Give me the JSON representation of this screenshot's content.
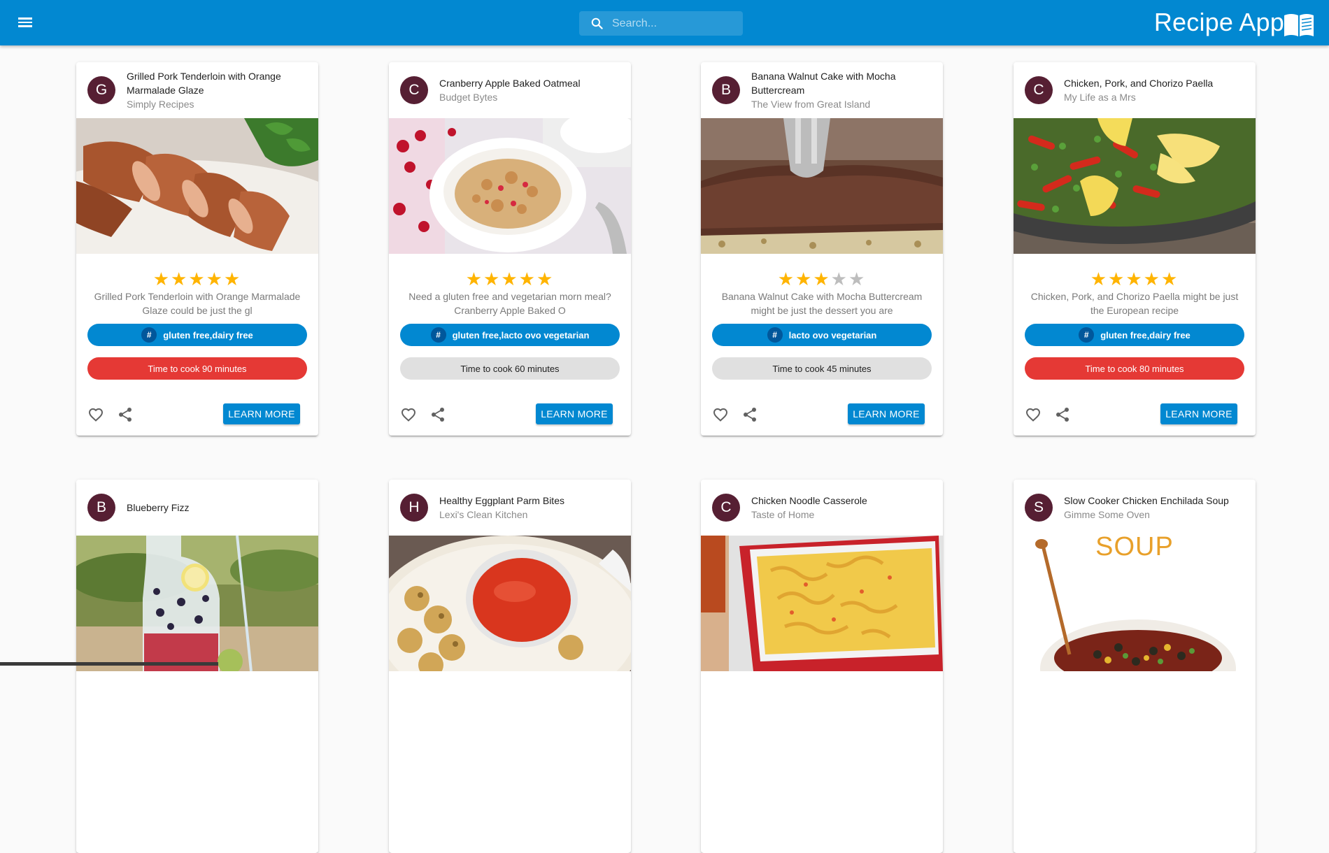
{
  "appbar": {
    "title": "Recipe App",
    "search_placeholder": "Search...",
    "brand_color": "#0288d1",
    "icons": [
      "menu-icon",
      "search-icon",
      "open-book-icon"
    ]
  },
  "cards": [
    {
      "avatar": "G",
      "title": "Grilled Pork Tenderloin with Orange Marmalade Glaze",
      "source": "Simply Recipes",
      "rating": 5,
      "description": "Grilled Pork Tenderloin with Orange Marmalade Glaze could be just the gl",
      "tag_symbol": "#",
      "tags": "gluten free,dairy free",
      "cook_time": "Time to cook 90 minutes",
      "time_style": "hot",
      "button": "LEARN MORE"
    },
    {
      "avatar": "C",
      "title": "Cranberry Apple Baked Oatmeal",
      "source": "Budget Bytes",
      "rating": 5,
      "description": "Need a gluten free and vegetarian morn meal? Cranberry Apple Baked O",
      "tag_symbol": "#",
      "tags": "gluten free,lacto ovo vegetarian",
      "cook_time": "Time to cook 60 minutes",
      "time_style": "norm",
      "button": "LEARN MORE"
    },
    {
      "avatar": "B",
      "title": "Banana Walnut Cake with Mocha Buttercream",
      "source": "The View from Great Island",
      "rating": 3,
      "description": "Banana Walnut Cake with Mocha Buttercream might be just the dessert you are",
      "tag_symbol": "#",
      "tags": "lacto ovo vegetarian",
      "cook_time": "Time to cook 45 minutes",
      "time_style": "norm",
      "button": "LEARN MORE"
    },
    {
      "avatar": "C",
      "title": "Chicken, Pork, and Chorizo Paella",
      "source": "My Life as a Mrs",
      "rating": 5,
      "description": "Chicken, Pork, and Chorizo Paella might be just the European recipe",
      "tag_symbol": "#",
      "tags": "gluten free,dairy free",
      "cook_time": "Time to cook 80 minutes",
      "time_style": "hot",
      "button": "LEARN MORE"
    },
    {
      "avatar": "B",
      "title": "Blueberry Fizz",
      "source": "",
      "rating": 0,
      "description": "",
      "tag_symbol": "",
      "tags": "",
      "cook_time": "",
      "time_style": "norm",
      "button": ""
    },
    {
      "avatar": "H",
      "title": "Healthy Eggplant Parm Bites",
      "source": "Lexi's Clean Kitchen",
      "rating": 0,
      "description": "",
      "tag_symbol": "",
      "tags": "",
      "cook_time": "",
      "time_style": "norm",
      "button": ""
    },
    {
      "avatar": "C",
      "title": "Chicken Noodle Casserole",
      "source": "Taste of Home",
      "rating": 0,
      "description": "",
      "tag_symbol": "",
      "tags": "",
      "cook_time": "",
      "time_style": "norm",
      "button": ""
    },
    {
      "avatar": "S",
      "title": "Slow Cooker Chicken Enchilada Soup",
      "source": "Gimme Some Oven",
      "rating": 0,
      "description": "",
      "tag_symbol": "",
      "tags": "",
      "cook_time": "",
      "time_style": "norm",
      "button": "",
      "image_text": "SOUP"
    }
  ]
}
